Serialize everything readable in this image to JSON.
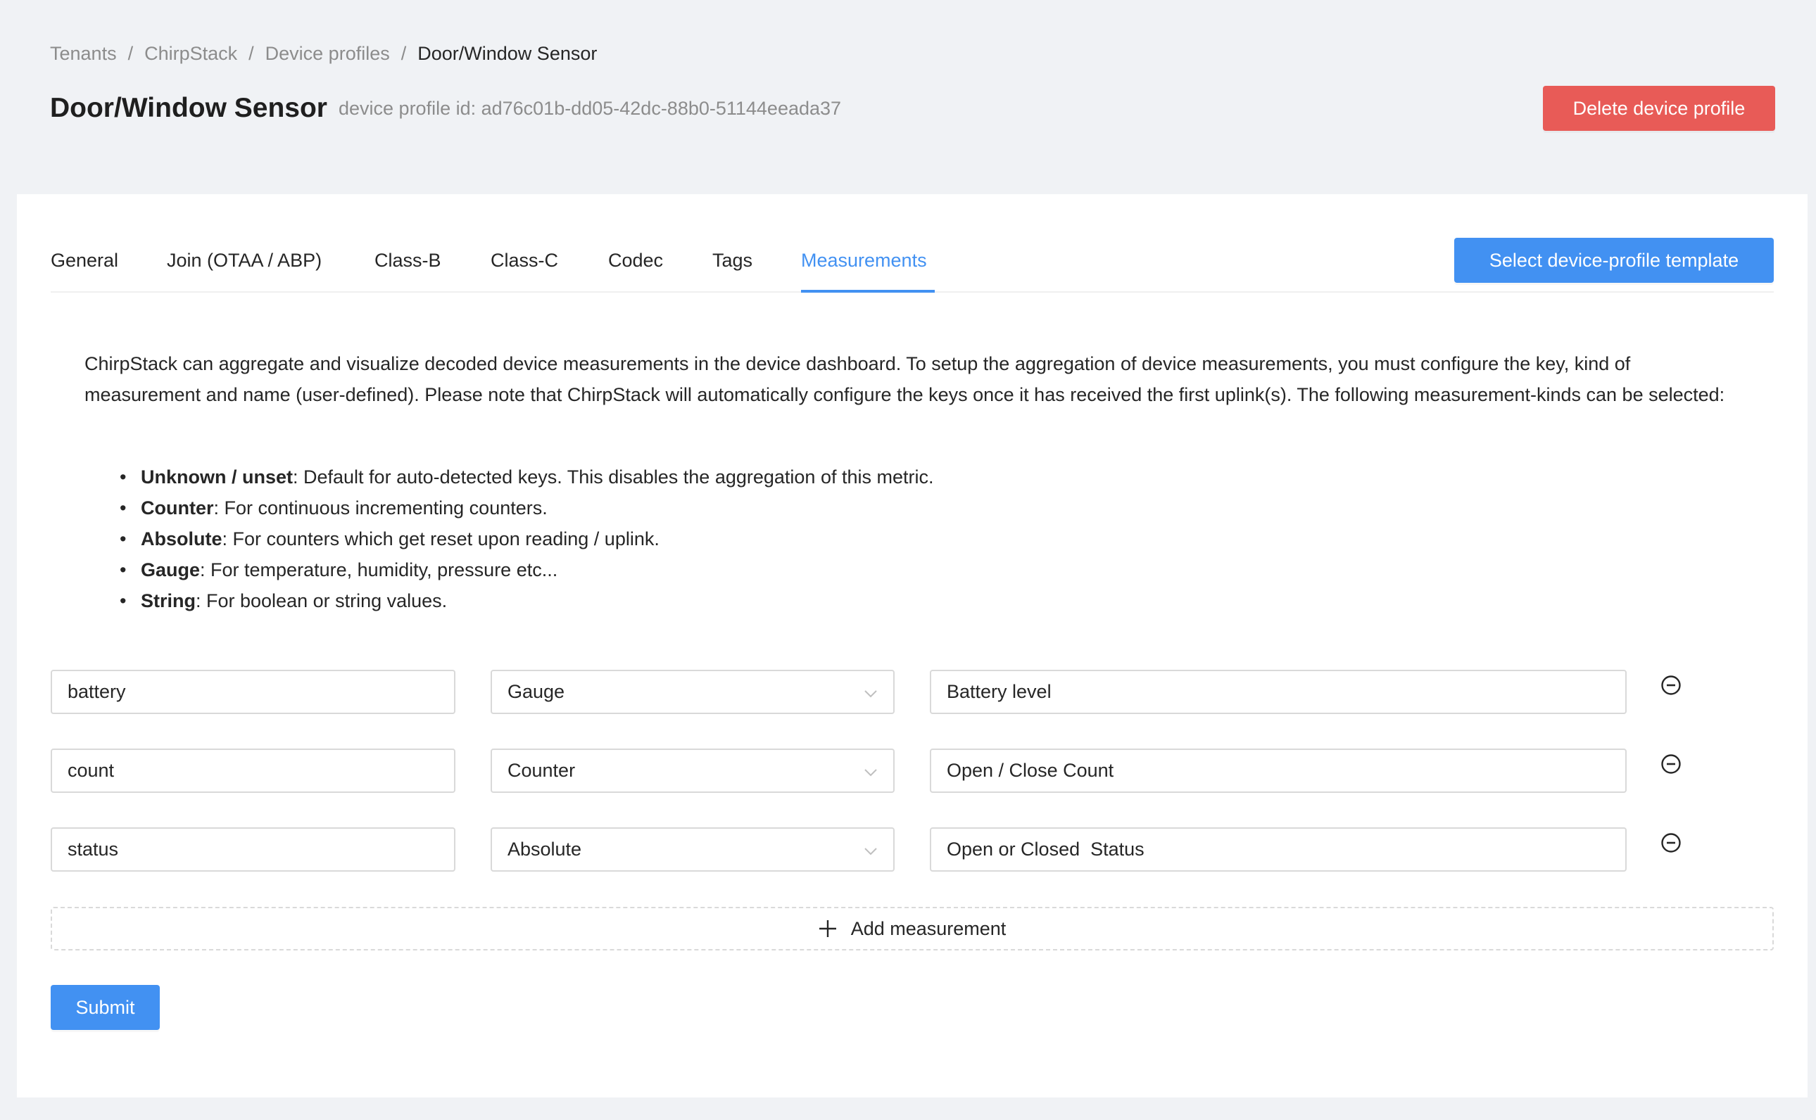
{
  "breadcrumb": [
    {
      "label": "Tenants"
    },
    {
      "label": "ChirpStack"
    },
    {
      "label": "Device profiles"
    },
    {
      "label": "Door/Window Sensor"
    }
  ],
  "breadcrumb_separator": "/",
  "header": {
    "title": "Door/Window Sensor",
    "subtitle": "device profile id: ad76c01b-dd05-42dc-88b0-51144eeada37",
    "delete_label": "Delete device profile"
  },
  "tabs": [
    {
      "label": "General",
      "active": false
    },
    {
      "label": "Join (OTAA / ABP)",
      "active": false
    },
    {
      "label": "Class-B",
      "active": false
    },
    {
      "label": "Class-C",
      "active": false
    },
    {
      "label": "Codec",
      "active": false
    },
    {
      "label": "Tags",
      "active": false
    },
    {
      "label": "Measurements",
      "active": true
    }
  ],
  "template_button_label": "Select device-profile template",
  "intro": "ChirpStack can aggregate and visualize decoded device measurements in the device dashboard. To setup the aggregation of device measurements, you must configure the key, kind of measurement and name (user-defined). Please note that ChirpStack will automatically configure the keys once it has received the first uplink(s). The following measurement-kinds can be selected:",
  "kinds": [
    {
      "name": "Unknown / unset",
      "desc": ": Default for auto-detected keys. This disables the aggregation of this metric."
    },
    {
      "name": "Counter",
      "desc": ": For continuous incrementing counters."
    },
    {
      "name": "Absolute",
      "desc": ": For counters which get reset upon reading / uplink."
    },
    {
      "name": "Gauge",
      "desc": ": For temperature, humidity, pressure etc..."
    },
    {
      "name": "String",
      "desc": ": For boolean or string values."
    }
  ],
  "measurements": [
    {
      "key": "battery",
      "kind": "Gauge",
      "name": "Battery level"
    },
    {
      "key": "count",
      "kind": "Counter",
      "name": "Open / Close Count"
    },
    {
      "key": "status",
      "kind": "Absolute",
      "name": "Open or Closed  Status"
    }
  ],
  "add_measurement_label": "Add measurement",
  "submit_label": "Submit",
  "colors": {
    "primary": "#4291f2",
    "danger": "#e85b57",
    "background": "#f0f2f5"
  }
}
